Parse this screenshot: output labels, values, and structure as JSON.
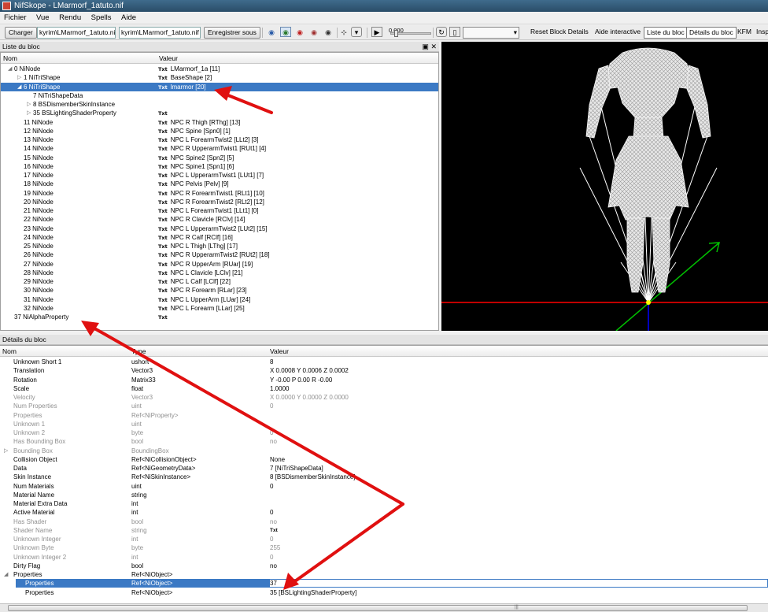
{
  "window": {
    "title": "NifSkope - LMarmorf_1atuto.nif"
  },
  "menu": [
    "Fichier",
    "Vue",
    "Rendu",
    "Spells",
    "Aide"
  ],
  "toolbar": {
    "load_label": "Charger",
    "path_left": "kyrim\\LMarmorf_1atuto.nif",
    "path_right": "kyrim\\LMarmorf_1atuto.nif",
    "save_label": "Enregistrer sous",
    "time_value": "0.000",
    "reset_label": "Reset Block Details",
    "help_label": "Aide interactive",
    "block_list_label": "Liste du bloc",
    "block_details_label": "Détails du bloc",
    "kfm_label": "KFM",
    "insp_label": "Insp"
  },
  "block_list": {
    "title": "Liste du bloc",
    "col_name": "Nom",
    "col_value": "Valeur",
    "rows": [
      {
        "name": "0 NiNode",
        "value": "LMarmorf_1a [11]",
        "indent": 0,
        "arrow": "open"
      },
      {
        "name": "1 NiTriShape",
        "value": "BaseShape [2]",
        "indent": 1,
        "arrow": "closed"
      },
      {
        "name": "6 NiTriShape",
        "value": "lmarmor [20]",
        "indent": 1,
        "arrow": "open",
        "selected": true
      },
      {
        "name": "7 NiTriShapeData",
        "value": "",
        "indent": 2,
        "arrow": "none"
      },
      {
        "name": "8 BSDismemberSkinInstance",
        "value": "",
        "indent": 2,
        "arrow": "closed"
      },
      {
        "name": "35 BSLightingShaderProperty",
        "value": "",
        "indent": 2,
        "arrow": "closed"
      },
      {
        "name": "11 NiNode",
        "value": "NPC R Thigh [RThg] [13]",
        "indent": 1,
        "arrow": "none"
      },
      {
        "name": "12 NiNode",
        "value": "NPC Spine [Spn0] [1]",
        "indent": 1,
        "arrow": "none"
      },
      {
        "name": "13 NiNode",
        "value": "NPC L ForearmTwist2 [LLt2] [3]",
        "indent": 1,
        "arrow": "none"
      },
      {
        "name": "14 NiNode",
        "value": "NPC R UpperarmTwist1 [RUt1] [4]",
        "indent": 1,
        "arrow": "none"
      },
      {
        "name": "15 NiNode",
        "value": "NPC Spine2 [Spn2] [5]",
        "indent": 1,
        "arrow": "none"
      },
      {
        "name": "16 NiNode",
        "value": "NPC Spine1 [Spn1] [6]",
        "indent": 1,
        "arrow": "none"
      },
      {
        "name": "17 NiNode",
        "value": "NPC L UpperarmTwist1 [LUt1] [7]",
        "indent": 1,
        "arrow": "none"
      },
      {
        "name": "18 NiNode",
        "value": "NPC Pelvis [Pelv] [9]",
        "indent": 1,
        "arrow": "none"
      },
      {
        "name": "19 NiNode",
        "value": "NPC R ForearmTwist1 [RLt1] [10]",
        "indent": 1,
        "arrow": "none"
      },
      {
        "name": "20 NiNode",
        "value": "NPC R ForearmTwist2 [RLt2] [12]",
        "indent": 1,
        "arrow": "none"
      },
      {
        "name": "21 NiNode",
        "value": "NPC L ForearmTwist1 [LLt1] [0]",
        "indent": 1,
        "arrow": "none"
      },
      {
        "name": "22 NiNode",
        "value": "NPC R Clavicle [RClv] [14]",
        "indent": 1,
        "arrow": "none"
      },
      {
        "name": "23 NiNode",
        "value": "NPC L UpperarmTwist2 [LUt2] [15]",
        "indent": 1,
        "arrow": "none"
      },
      {
        "name": "24 NiNode",
        "value": "NPC R Calf [RClf] [16]",
        "indent": 1,
        "arrow": "none"
      },
      {
        "name": "25 NiNode",
        "value": "NPC L Thigh [LThg] [17]",
        "indent": 1,
        "arrow": "none"
      },
      {
        "name": "26 NiNode",
        "value": "NPC R UpperarmTwist2 [RUt2] [18]",
        "indent": 1,
        "arrow": "none"
      },
      {
        "name": "27 NiNode",
        "value": "NPC R UpperArm [RUar] [19]",
        "indent": 1,
        "arrow": "none"
      },
      {
        "name": "28 NiNode",
        "value": "NPC L Clavicle [LClv] [21]",
        "indent": 1,
        "arrow": "none"
      },
      {
        "name": "29 NiNode",
        "value": "NPC L Calf [LClf] [22]",
        "indent": 1,
        "arrow": "none"
      },
      {
        "name": "30 NiNode",
        "value": "NPC R Forearm [RLar] [23]",
        "indent": 1,
        "arrow": "none"
      },
      {
        "name": "31 NiNode",
        "value": "NPC L UpperArm [LUar] [24]",
        "indent": 1,
        "arrow": "none"
      },
      {
        "name": "32 NiNode",
        "value": "NPC L Forearm [LLar] [25]",
        "indent": 1,
        "arrow": "none"
      },
      {
        "name": "37 NiAlphaProperty",
        "value": "",
        "indent": 0,
        "arrow": "none"
      }
    ],
    "txt_badge": "Txt"
  },
  "block_details": {
    "title": "Détails du bloc",
    "col_name": "Nom",
    "col_type": "Type",
    "col_value": "Valeur",
    "rows": [
      {
        "name": "Unknown Short 1",
        "type": "ushort",
        "value": "8",
        "gray": false
      },
      {
        "name": "Translation",
        "type": "Vector3",
        "value": "X 0.0008 Y 0.0006 Z 0.0002",
        "gray": false
      },
      {
        "name": "Rotation",
        "type": "Matrix33",
        "value": "Y -0.00 P 0.00 R -0.00",
        "gray": false
      },
      {
        "name": "Scale",
        "type": "float",
        "value": "1.0000",
        "gray": false
      },
      {
        "name": "Velocity",
        "type": "Vector3",
        "value": "X 0.0000 Y 0.0000 Z 0.0000",
        "gray": true
      },
      {
        "name": "Num Properties",
        "type": "uint",
        "value": "0",
        "gray": true
      },
      {
        "name": "Properties",
        "type": "Ref<NiProperty>",
        "value": "",
        "gray": true
      },
      {
        "name": "Unknown 1",
        "type": "uint",
        "value": "",
        "gray": true
      },
      {
        "name": "Unknown 2",
        "type": "byte",
        "value": "0",
        "gray": true
      },
      {
        "name": "Has Bounding Box",
        "type": "bool",
        "value": "no",
        "gray": true
      },
      {
        "name": "Bounding Box",
        "type": "BoundingBox",
        "value": "",
        "gray": true,
        "arrow": "closed"
      },
      {
        "name": "Collision Object",
        "type": "Ref<NiCollisionObject>",
        "value": "None",
        "gray": false
      },
      {
        "name": "Data",
        "type": "Ref<NiGeometryData>",
        "value": "7 [NiTriShapeData]",
        "gray": false
      },
      {
        "name": "Skin Instance",
        "type": "Ref<NiSkinInstance>",
        "value": "8 [BSDismemberSkinInstance]",
        "gray": false
      },
      {
        "name": "Num Materials",
        "type": "uint",
        "value": "0",
        "gray": false
      },
      {
        "name": "Material Name",
        "type": "string",
        "value": "",
        "gray": false
      },
      {
        "name": "Material Extra Data",
        "type": "int",
        "value": "",
        "gray": false
      },
      {
        "name": "Active Material",
        "type": "int",
        "value": "0",
        "gray": false
      },
      {
        "name": "Has Shader",
        "type": "bool",
        "value": "no",
        "gray": true
      },
      {
        "name": "Shader Name",
        "type": "string",
        "value": "Txt",
        "gray": true
      },
      {
        "name": "Unknown Integer",
        "type": "int",
        "value": "0",
        "gray": true
      },
      {
        "name": "Unknown Byte",
        "type": "byte",
        "value": "255",
        "gray": true
      },
      {
        "name": "Unknown Integer 2",
        "type": "int",
        "value": "0",
        "gray": true
      },
      {
        "name": "Dirty Flag",
        "type": "bool",
        "value": "no",
        "gray": false
      },
      {
        "name": "Properties",
        "type": "Ref<NiObject>",
        "value": "",
        "gray": false,
        "arrow": "open"
      },
      {
        "name": "Properties",
        "type": "Ref<NiObject>",
        "value": "37",
        "gray": false,
        "sub": true,
        "selected": true
      },
      {
        "name": "Properties",
        "type": "Ref<NiObject>",
        "value": "35 [BSLightingShaderProperty]",
        "gray": false,
        "sub": true
      }
    ]
  },
  "colors": {
    "selection": "#3b79c4",
    "annotation_arrow": "#e01010",
    "x_axis": "#ff0000",
    "y_axis": "#00c000",
    "z_axis": "#0000ff"
  }
}
